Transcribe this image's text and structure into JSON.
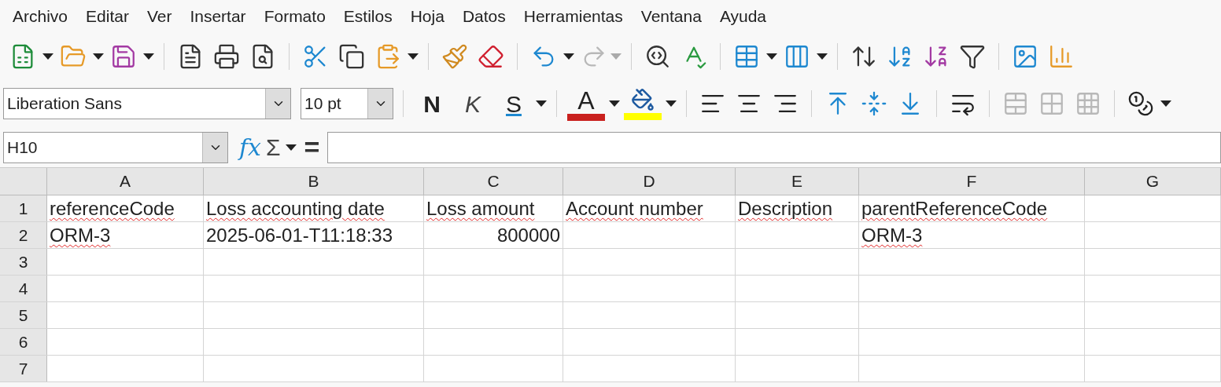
{
  "menu": [
    "Archivo",
    "Editar",
    "Ver",
    "Insertar",
    "Formato",
    "Estilos",
    "Hoja",
    "Datos",
    "Herramientas",
    "Ventana",
    "Ayuda"
  ],
  "standard_toolbar": {
    "redo_disabled": true
  },
  "format_toolbar": {
    "font_name": "Liberation Sans",
    "font_size": "10 pt",
    "bold": "N",
    "italic": "K",
    "underline": "S",
    "font_color": {
      "label": "A",
      "color": "#c9211e"
    },
    "highlight_color": {
      "color": "#ffff00"
    },
    "merge_disabled": true
  },
  "formula_bar": {
    "name_box": "H10",
    "function_wizard": "fx",
    "sum": "Σ",
    "equals": "="
  },
  "sheet": {
    "columns": [
      "A",
      "B",
      "C",
      "D",
      "E",
      "F",
      "G"
    ],
    "rows": [
      {
        "header": "1",
        "cells": [
          {
            "text": "referenceCode",
            "spell_error": true
          },
          {
            "text": "Loss accounting date",
            "spell_error": true
          },
          {
            "text": "Loss amount",
            "spell_error": true
          },
          {
            "text": "Account number",
            "spell_error": true
          },
          {
            "text": "Description",
            "spell_error": true
          },
          {
            "text": "parentReferenceCode",
            "spell_error": true
          },
          null
        ]
      },
      {
        "header": "2",
        "cells": [
          {
            "text": "ORM-3",
            "spell_error": true
          },
          {
            "text": "2025-06-01-T11:18:33",
            "spell_error": false
          },
          {
            "text": "800000",
            "spell_error": false,
            "numeric": true
          },
          null,
          null,
          {
            "text": "ORM-3",
            "spell_error": true
          },
          null
        ]
      },
      {
        "header": "3",
        "cells": []
      },
      {
        "header": "4",
        "cells": []
      },
      {
        "header": "5",
        "cells": []
      },
      {
        "header": "6",
        "cells": []
      },
      {
        "header": "7",
        "cells": []
      }
    ]
  }
}
